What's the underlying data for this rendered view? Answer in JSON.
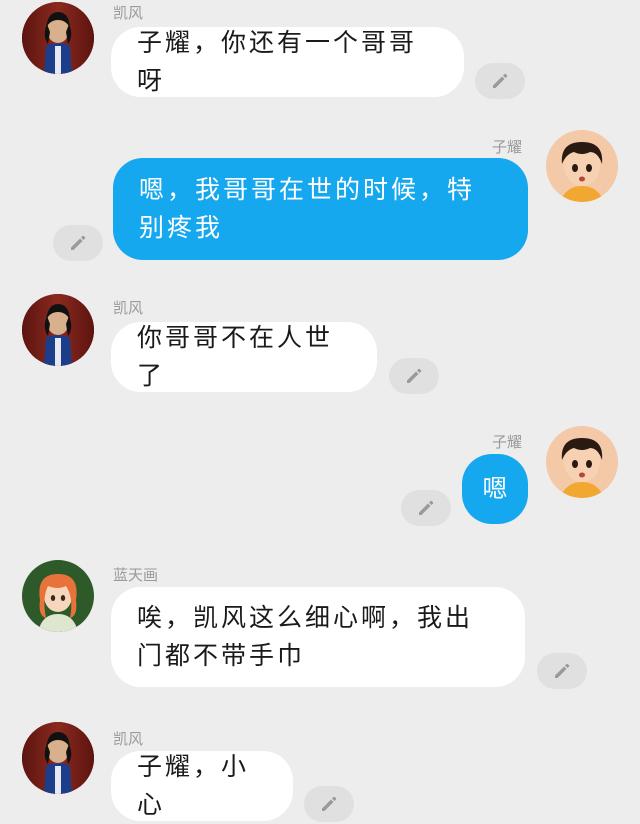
{
  "messages": [
    {
      "sender": "凯风",
      "side": "left",
      "text": "子耀，你还有一个哥哥呀",
      "avatar": "kaifeng-avatar"
    },
    {
      "sender": "子耀",
      "side": "right",
      "text": "嗯，我哥哥在世的时候，特别疼我",
      "avatar": "ziyao-avatar"
    },
    {
      "sender": "凯风",
      "side": "left",
      "text": "你哥哥不在人世了",
      "avatar": "kaifeng-avatar"
    },
    {
      "sender": "子耀",
      "side": "right",
      "text": "嗯",
      "avatar": "ziyao-avatar"
    },
    {
      "sender": "蓝天画",
      "side": "left",
      "text": "唉，凯风这么细心啊，我出门都不带手巾",
      "avatar": "lantianhua-avatar"
    },
    {
      "sender": "凯风",
      "side": "left",
      "text": "子耀，小心",
      "avatar": "kaifeng-avatar"
    }
  ],
  "colors": {
    "background": "#ededed",
    "left_bubble": "#ffffff",
    "right_bubble": "#16a8ef",
    "edit_button": "#e0e0e0",
    "name_text": "#9a9a9a"
  },
  "icons": {
    "edit": "pencil-icon"
  }
}
